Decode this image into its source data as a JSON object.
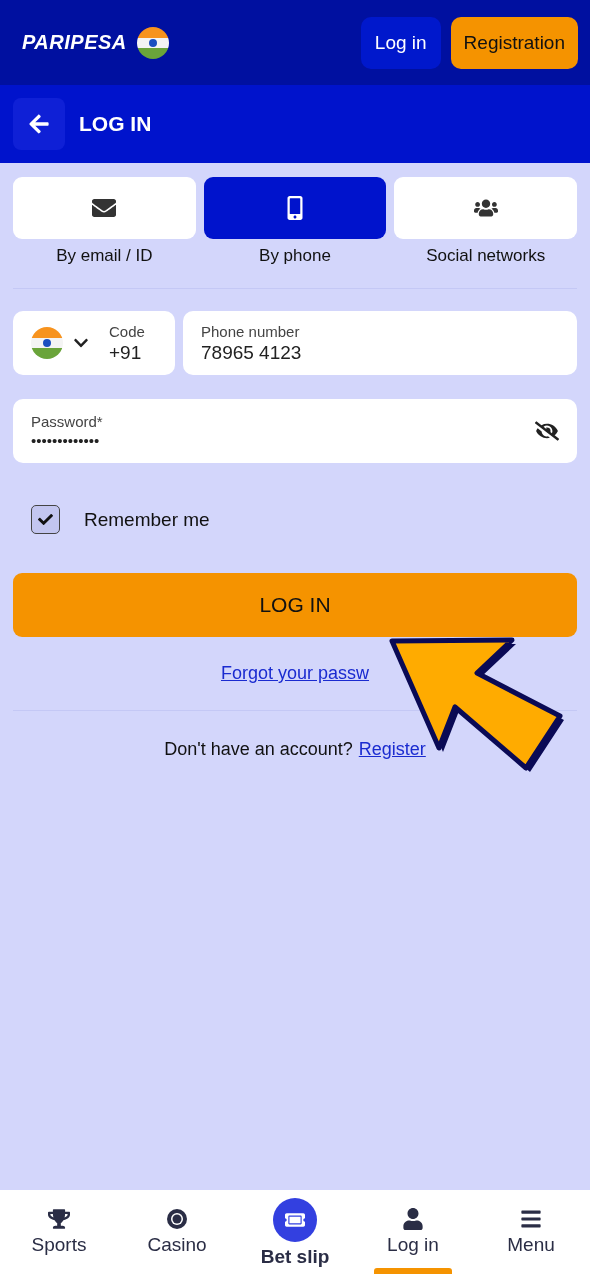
{
  "header": {
    "logo": "PARIPESA",
    "login_button": "Log in",
    "register_button": "Registration"
  },
  "page_header": {
    "title": "LOG IN"
  },
  "tabs": [
    {
      "label": "By email / ID",
      "selected": false
    },
    {
      "label": "By phone",
      "selected": true
    },
    {
      "label": "Social networks",
      "selected": false
    }
  ],
  "phone": {
    "code_label": "Code",
    "code_value": "+91",
    "number_label": "Phone number",
    "number_value": "78965 4123"
  },
  "password": {
    "label": "Password*",
    "value": "•••••••••••••"
  },
  "remember": {
    "label": "Remember me",
    "checked": true
  },
  "submit": "LOG IN",
  "forgot_link": "Forgot your passw",
  "signup": {
    "text": "Don't have an account?",
    "link": "Register"
  },
  "nav": [
    {
      "label": "Sports",
      "kind": "plain",
      "selected": false
    },
    {
      "label": "Casino",
      "kind": "plain",
      "selected": false
    },
    {
      "label": "Bet slip",
      "kind": "featured",
      "selected": false
    },
    {
      "label": "Log in",
      "kind": "plain",
      "selected": true
    },
    {
      "label": "Menu",
      "kind": "plain",
      "selected": false
    }
  ]
}
